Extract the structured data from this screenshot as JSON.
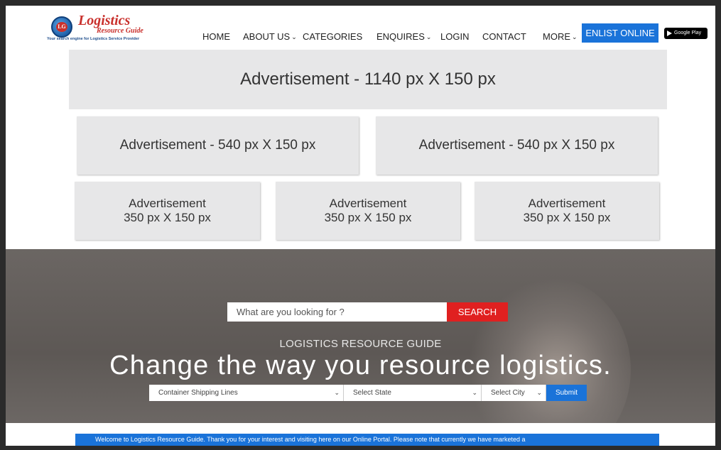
{
  "logo": {
    "badge": "LG",
    "title": "Logistics",
    "subtitle": "Resource Guide",
    "tagline": "Your search engine for Logistics Service Provider"
  },
  "nav": {
    "home": "HOME",
    "about": "ABOUT US",
    "categories": "CATEGORIES",
    "enquires": "ENQUIRES",
    "login": "LOGIN",
    "contact": "CONTACT",
    "more": "MORE",
    "enlist": "ENLIST ONLINE",
    "google_play": "Google Play",
    "chevron": "⌄"
  },
  "ads": {
    "banner": "Advertisement - 1140 px X  150 px",
    "medium": [
      "Advertisement - 540 px X  150 px",
      "Advertisement - 540 px X  150 px"
    ],
    "small_title": "Advertisement",
    "small_size": "350 px X  150 px"
  },
  "hero": {
    "search_placeholder": "What are you looking for ?",
    "search_button": "SEARCH",
    "subtitle": "LOGISTICS RESOURCE GUIDE",
    "title": "Change the way you resource logistics.",
    "category_select": "Container Shipping Lines",
    "state_select": "Select State",
    "city_select": "Select City",
    "submit": "Submit"
  },
  "welcome": "Welcome to Logistics Resource Guide. Thank you for your interest and visiting here on our Online Portal. Please note that currently we have marketed a",
  "colors": {
    "accent_blue": "#1a73d9",
    "accent_red": "#e02020",
    "brand_red": "#c9302c"
  }
}
